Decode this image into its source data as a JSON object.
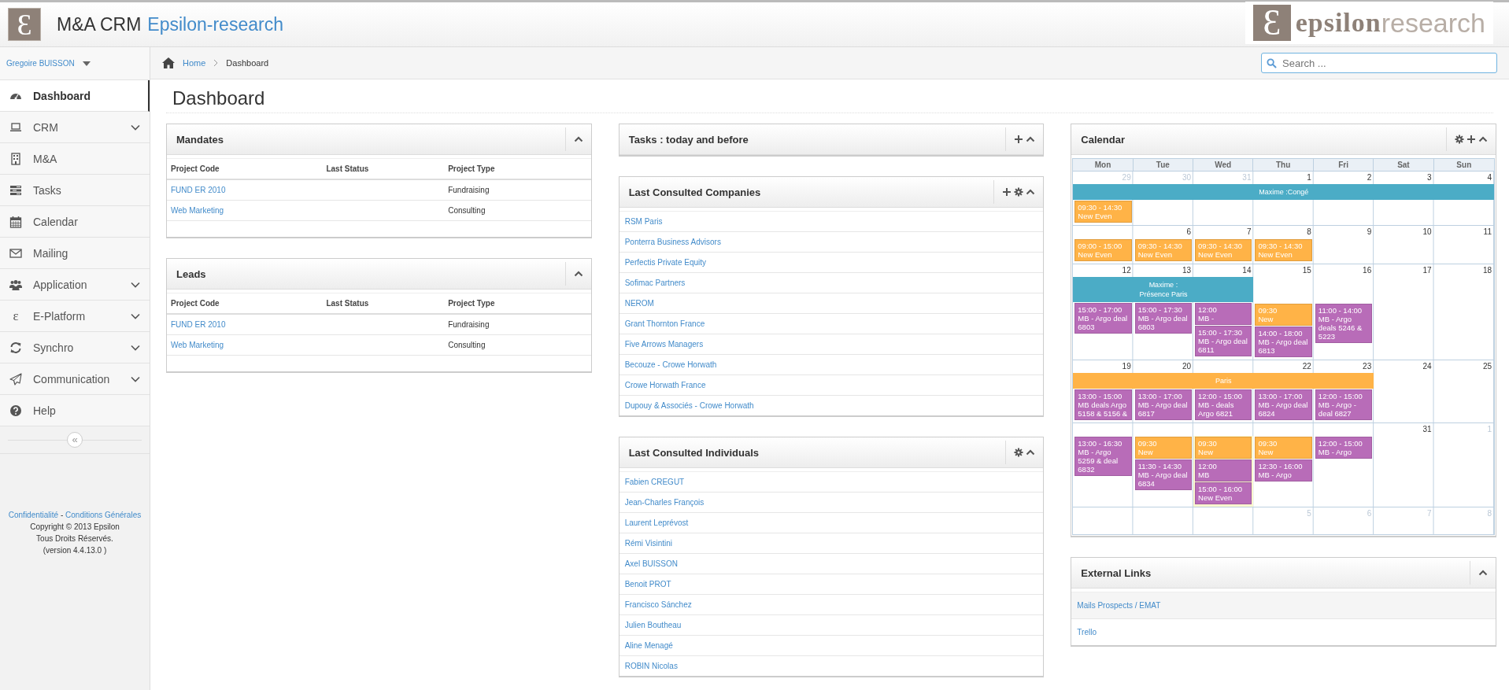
{
  "header": {
    "logo_mark": "Ɛ",
    "app_name": "M&A CRM",
    "company": "Epsilon-research",
    "brand_logo": {
      "mark": "Ɛ",
      "word_strong": "epsilon",
      "word_light": "research"
    }
  },
  "sidebar": {
    "user": "Gregoire BUISSON",
    "items": [
      {
        "label": "Dashboard",
        "selected": true,
        "expandable": false
      },
      {
        "label": "CRM",
        "selected": false,
        "expandable": true
      },
      {
        "label": "M&A",
        "selected": false,
        "expandable": false
      },
      {
        "label": "Tasks",
        "selected": false,
        "expandable": false
      },
      {
        "label": "Calendar",
        "selected": false,
        "expandable": false
      },
      {
        "label": "Mailing",
        "selected": false,
        "expandable": false
      },
      {
        "label": "Application",
        "selected": false,
        "expandable": true
      },
      {
        "label": "E-Platform",
        "selected": false,
        "expandable": true,
        "glyph": "ε"
      },
      {
        "label": "Synchro",
        "selected": false,
        "expandable": true
      },
      {
        "label": "Communication",
        "selected": false,
        "expandable": true
      },
      {
        "label": "Help",
        "selected": false,
        "expandable": false
      }
    ],
    "collapse": "«",
    "footer": {
      "links": [
        "Confidentialité",
        "Conditions Générales"
      ],
      "separator": "-",
      "lines": [
        "Copyright © 2013 Epsilon",
        "Tous Droits Réservés.",
        "(version 4.4.13.0 )"
      ]
    }
  },
  "breadcrumb": [
    "Home",
    "Dashboard"
  ],
  "search": {
    "placeholder": "Search ..."
  },
  "page_title": "Dashboard",
  "mandates": {
    "title": "Mandates",
    "tools": [
      {
        "kind": "collapse"
      }
    ],
    "columns": [
      "Project Code",
      "Last Status",
      "Project Type"
    ],
    "rows": [
      {
        "project_code": "FUND ER 2010",
        "project_type": "Fundraising"
      },
      {
        "project_code": "Web Marketing",
        "project_type": "Consulting"
      }
    ]
  },
  "leads": {
    "title": "Leads",
    "tools": [
      {
        "kind": "collapse"
      }
    ],
    "columns": [
      "Project Code",
      "Last Status",
      "Project Type"
    ],
    "rows": [
      {
        "project_code": "FUND ER 2010",
        "project_type": "Fundraising"
      },
      {
        "project_code": "Web Marketing",
        "project_type": "Consulting"
      }
    ]
  },
  "tasks": {
    "title": "Tasks : today and before",
    "tools": [
      {
        "kind": "add"
      },
      {
        "kind": "collapse"
      }
    ]
  },
  "companies": {
    "title": "Last Consulted Companies",
    "tools": [
      {
        "kind": "add"
      },
      {
        "kind": "settings"
      },
      {
        "kind": "collapse"
      }
    ],
    "items": [
      "RSM Paris",
      "Ponterra Business Advisors",
      "Perfectis Private Equity",
      "Sofimac Partners",
      "NEROM",
      "Grant Thornton France",
      "Five Arrows Managers",
      "Becouze - Crowe Horwath",
      "Crowe Horwath France",
      "Dupouy & Associés - Crowe Horwath"
    ]
  },
  "individuals": {
    "title": "Last Consulted Individuals",
    "tools": [
      {
        "kind": "settings"
      },
      {
        "kind": "collapse"
      }
    ],
    "items": [
      "Fabien CREGUT",
      "Jean-Charles François",
      "Laurent Leprévost",
      "Rémi Visintini",
      "Axel BUISSON",
      "Benoit PROT",
      "Francisco Sánchez",
      "Julien Boutheau",
      "Aline Menagé",
      "ROBIN Nicolas"
    ]
  },
  "calendar": {
    "title": "Calendar",
    "tools": [
      {
        "kind": "settings"
      },
      {
        "kind": "add"
      },
      {
        "kind": "collapse"
      }
    ],
    "weekdays": [
      "Mon",
      "Tue",
      "Wed",
      "Thu",
      "Fri",
      "Sat",
      "Sun"
    ],
    "weeks": [
      {
        "banner": {
          "title": "Maxime :Congé",
          "color": "#4bacc6"
        },
        "days": [
          {
            "number": "29",
            "other_month": true,
            "today": false,
            "in_banner": true,
            "events": [
              {
                "time": "09:30 - 14:30",
                "title": "New Even",
                "color": "#ffb347"
              }
            ]
          },
          {
            "number": "30",
            "other_month": true,
            "today": false,
            "in_banner": true
          },
          {
            "number": "31",
            "other_month": true,
            "today": false,
            "in_banner": true
          },
          {
            "number": "1",
            "other_month": false,
            "today": false,
            "in_banner": true
          },
          {
            "number": "2",
            "other_month": false,
            "today": false,
            "in_banner": true
          },
          {
            "number": "3",
            "other_month": false,
            "today": false,
            "in_banner": true
          },
          {
            "number": "4",
            "other_month": false,
            "today": false,
            "in_banner": true
          }
        ]
      },
      {
        "days": [
          {
            "today": false,
            "events": [
              {
                "time": "09:00 - 15:00",
                "title": "New Even",
                "color": "#ffb347"
              }
            ]
          },
          {
            "number": "6",
            "other_month": false,
            "today": false,
            "events": [
              {
                "time": "09:30 - 14:30",
                "title": "New Even",
                "color": "#ffb347"
              }
            ]
          },
          {
            "number": "7",
            "other_month": false,
            "today": false,
            "events": [
              {
                "time": "09:30 - 14:30",
                "title": "New Even",
                "color": "#ffb347"
              }
            ]
          },
          {
            "number": "8",
            "other_month": false,
            "today": false,
            "events": [
              {
                "time": "09:30 - 14:30",
                "title": "New Even",
                "color": "#ffb347"
              }
            ]
          },
          {
            "number": "9",
            "other_month": false,
            "today": false
          },
          {
            "number": "10",
            "other_month": false,
            "today": false
          },
          {
            "number": "11",
            "other_month": false,
            "today": false
          }
        ]
      },
      {
        "banner": {
          "title": "Maxime : Présence Paris",
          "color": "#4bacc6"
        },
        "days": [
          {
            "number": "12",
            "other_month": false,
            "today": false,
            "in_banner": true,
            "events": [
              {
                "time": "15:00 - 17:00",
                "title": "MB - Argo deal 6803",
                "color": "#b86cb8"
              }
            ]
          },
          {
            "number": "13",
            "other_month": false,
            "today": false,
            "in_banner": true,
            "events": [
              {
                "time": "15:00 - 17:30",
                "title": "MB - Argo deal 6803",
                "color": "#b86cb8"
              }
            ]
          },
          {
            "number": "14",
            "other_month": false,
            "today": false,
            "in_banner": true,
            "events": [
              {
                "time": "12:00",
                "title": "MB -",
                "color": "#b86cb8"
              },
              {
                "time": "15:00 - 17:30",
                "title": "MB - Argo deal 6811",
                "color": "#b86cb8"
              }
            ]
          },
          {
            "number": "15",
            "other_month": false,
            "today": false,
            "in_banner": false,
            "events": [
              {
                "time": "09:30",
                "title": "New",
                "color": "#ffb347"
              },
              {
                "time": "14:00 - 18:00",
                "title": "MB - Argo deal 6813",
                "color": "#b86cb8"
              }
            ]
          },
          {
            "number": "16",
            "other_month": false,
            "today": false,
            "in_banner": false,
            "events": [
              {
                "time": "11:00 - 14:00",
                "title": "MB - Argo deals 5246 & 5223",
                "color": "#b86cb8"
              }
            ]
          },
          {
            "number": "17",
            "other_month": false,
            "today": false,
            "in_banner": false
          },
          {
            "number": "18",
            "other_month": false,
            "today": false,
            "in_banner": false
          }
        ]
      },
      {
        "banner": {
          "title": "Paris",
          "color": "#ffb347"
        },
        "days": [
          {
            "number": "19",
            "other_month": false,
            "today": false,
            "in_banner": true,
            "events": [
              {
                "time": "13:00 - 15:00",
                "title": "MB deals Argo 5158 & 5156 &",
                "color": "#b86cb8"
              }
            ]
          },
          {
            "number": "20",
            "other_month": false,
            "today": false,
            "in_banner": true,
            "events": [
              {
                "time": "13:00 - 17:00",
                "title": "MB - Argo deal 6817",
                "color": "#b86cb8"
              }
            ]
          },
          {
            "today": false,
            "in_banner": true,
            "events": [
              {
                "time": "12:00 - 15:00",
                "title": "MB - deals Argo 6821",
                "color": "#b86cb8"
              }
            ]
          },
          {
            "number": "22",
            "other_month": false,
            "today": false,
            "in_banner": true,
            "events": [
              {
                "time": "13:00 - 17:00",
                "title": "MB - Argo deal 6824",
                "color": "#b86cb8"
              }
            ]
          },
          {
            "number": "23",
            "other_month": false,
            "today": false,
            "in_banner": true,
            "events": [
              {
                "time": "12:00 - 15:00",
                "title": "MB - Argo - deal 6827",
                "color": "#b86cb8"
              }
            ]
          },
          {
            "number": "24",
            "other_month": false,
            "today": false,
            "in_banner": false
          },
          {
            "number": "25",
            "other_month": false,
            "today": false,
            "in_banner": false
          }
        ]
      },
      {
        "days": [
          {
            "today": false,
            "events": [
              {
                "time": "13:00 - 16:30",
                "title": "MB - Argo 5259 & deal 6832",
                "color": "#b86cb8"
              }
            ]
          },
          {
            "today": false,
            "events": [
              {
                "time": "09:30",
                "title": "New",
                "color": "#ffb347"
              },
              {
                "time": "11:30 - 14:30",
                "title": "MB - Argo deal 6834",
                "color": "#b86cb8"
              }
            ]
          },
          {
            "today": true,
            "events": [
              {
                "time": "09:30",
                "title": "New",
                "color": "#ffb347"
              },
              {
                "time": "12:00",
                "title": "MB",
                "color": "#b86cb8"
              },
              {
                "time": "15:00 - 16:00",
                "title": "New Even",
                "color": "#b86cb8"
              }
            ]
          },
          {
            "today": false,
            "events": [
              {
                "time": "09:30",
                "title": "New",
                "color": "#ffb347"
              },
              {
                "time": "12:30 - 16:00",
                "title": "MB - Argo",
                "color": "#b86cb8"
              }
            ]
          },
          {
            "today": false,
            "events": [
              {
                "time": "12:00 - 15:00",
                "title": "MB - Argo",
                "color": "#b86cb8"
              }
            ]
          },
          {
            "number": "31",
            "other_month": false,
            "today": false
          },
          {
            "number": "1",
            "other_month": true,
            "today": false
          }
        ]
      },
      {
        "days": [
          {
            "today": false
          },
          {
            "today": false
          },
          {
            "today": false
          },
          {
            "number": "5",
            "other_month": true,
            "today": false
          },
          {
            "number": "6",
            "other_month": true,
            "today": false
          },
          {
            "number": "7",
            "other_month": true,
            "today": false
          },
          {
            "number": "8",
            "other_month": true,
            "today": false
          }
        ]
      }
    ]
  },
  "external_links": {
    "title": "External Links",
    "tools": [
      {
        "kind": "collapse"
      }
    ],
    "items": [
      "Mails Prospects / EMAT",
      "Trello"
    ]
  }
}
